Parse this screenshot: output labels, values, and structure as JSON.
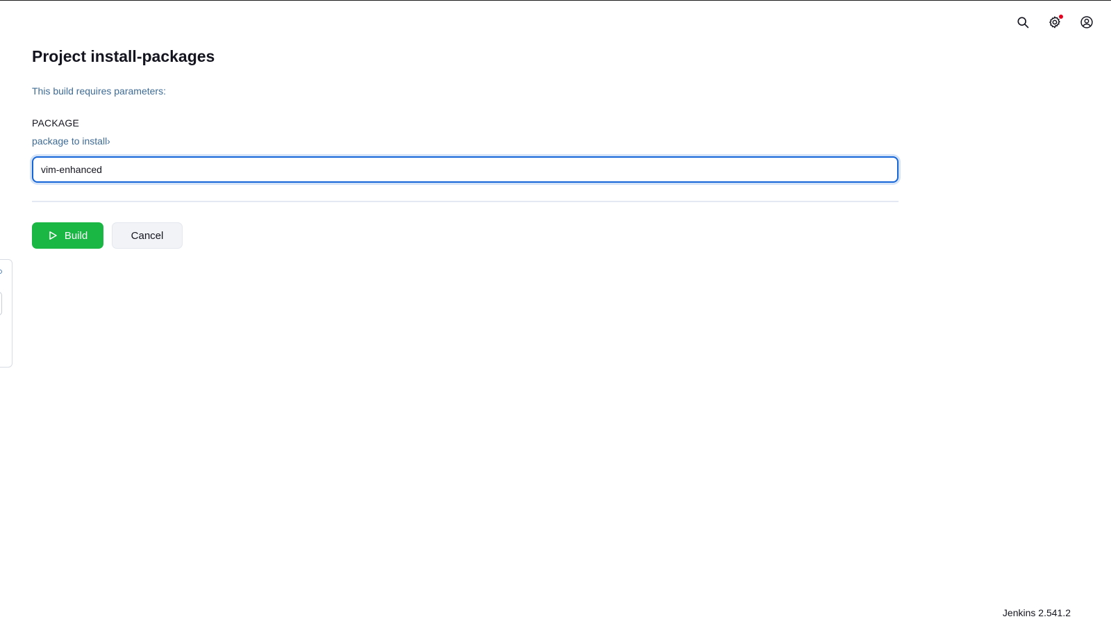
{
  "header": {
    "icons": [
      "search-icon",
      "gear-icon",
      "user-circle-icon"
    ],
    "notification_color": "#e6001f"
  },
  "main": {
    "title": "Project install-packages",
    "build_description": "This build requires parameters:",
    "parameter": {
      "name": "PACKAGE",
      "description": "package to install›",
      "value": "vim-enhanced"
    },
    "buttons": {
      "build_label": "Build",
      "cancel_label": "Cancel"
    }
  },
  "footer": {
    "version": "Jenkins 2.541.2"
  },
  "colors": {
    "accent": "#1565d8",
    "build_green": "#1ab745",
    "link_blue": "#3e6b95"
  }
}
